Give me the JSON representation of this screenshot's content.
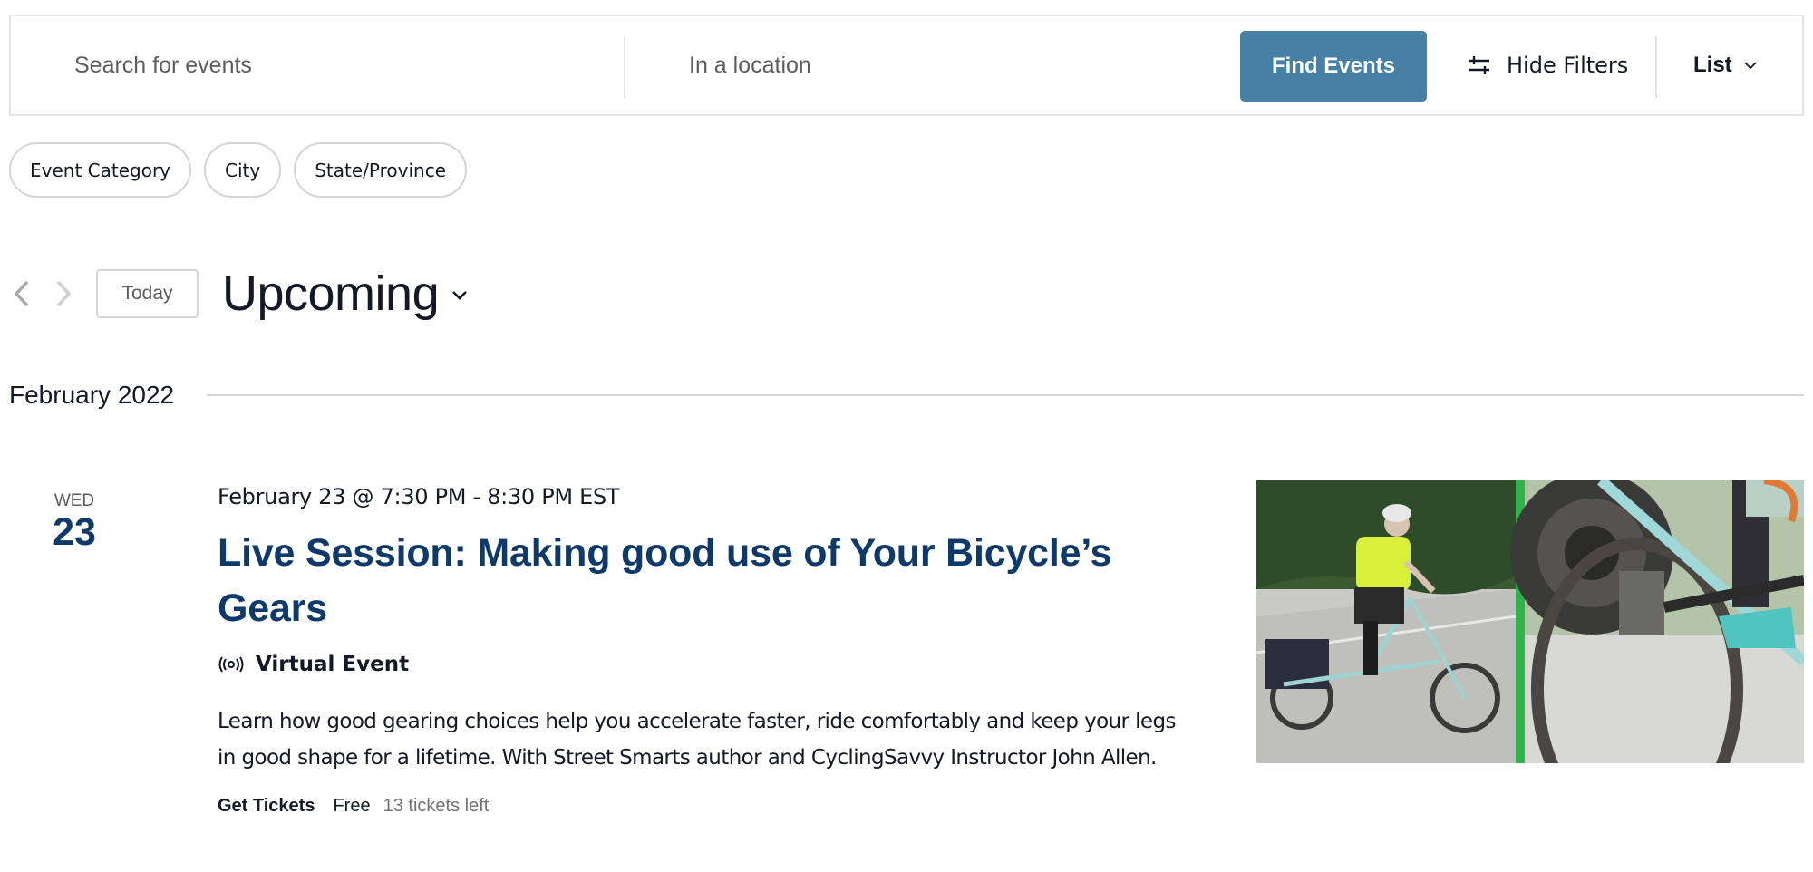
{
  "search": {
    "keyword_placeholder": "Search for events",
    "keyword_value": "",
    "location_placeholder": "In a location",
    "location_value": "",
    "find_button": "Find Events",
    "hide_filters": "Hide Filters",
    "view_selected": "List"
  },
  "filters": [
    {
      "label": "Event Category"
    },
    {
      "label": "City"
    },
    {
      "label": "State/Province"
    }
  ],
  "nav": {
    "today_label": "Today",
    "range_label": "Upcoming"
  },
  "month": {
    "label": "February 2022"
  },
  "event": {
    "weekday": "WED",
    "day": "23",
    "datetime": "February 23 @ 7:30 PM - 8:30 PM EST",
    "title": "Live Session: Making good use of Your Bicycle’s Gears",
    "virtual_label": "Virtual Event",
    "description": "Learn how good gearing choices help you accelerate faster, ride comfortably and keep your legs in good shape for a lifetime. With Street Smarts author and CyclingSavvy Instructor John Allen.",
    "tickets_label": "Get Tickets",
    "price": "Free",
    "tickets_left": "13 tickets left",
    "image_alt": "Cyclist in yellow shirt riding cargo bike; close-up of rear derailleur and cassette"
  },
  "colors": {
    "accent": "#4780a5",
    "title": "#0e3a6b",
    "text": "#141827",
    "muted": "#5d5d5d",
    "border": "#e4e4e4"
  }
}
